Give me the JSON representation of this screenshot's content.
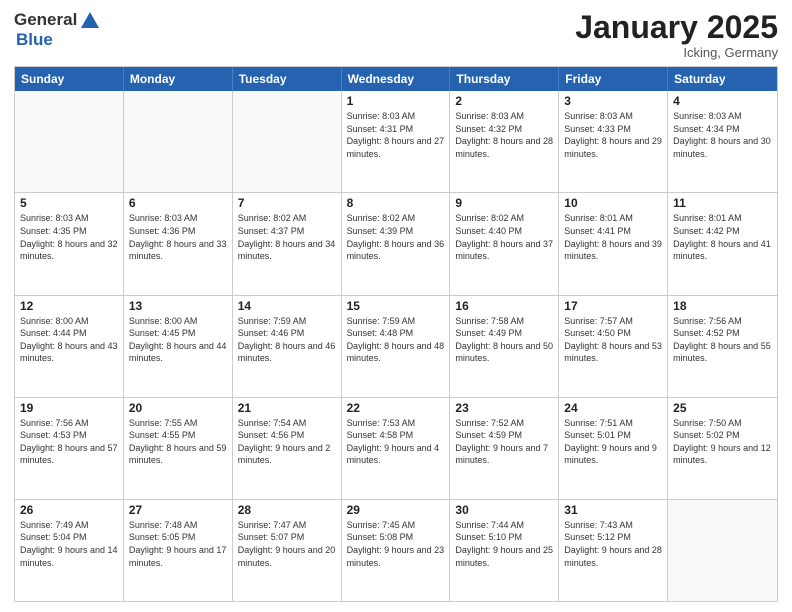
{
  "logo": {
    "general": "General",
    "blue": "Blue"
  },
  "header": {
    "month": "January 2025",
    "location": "Icking, Germany"
  },
  "weekdays": [
    "Sunday",
    "Monday",
    "Tuesday",
    "Wednesday",
    "Thursday",
    "Friday",
    "Saturday"
  ],
  "rows": [
    [
      {
        "day": "",
        "empty": true
      },
      {
        "day": "",
        "empty": true
      },
      {
        "day": "",
        "empty": true
      },
      {
        "day": "1",
        "sunrise": "8:03 AM",
        "sunset": "4:31 PM",
        "daylight": "8 hours and 27 minutes."
      },
      {
        "day": "2",
        "sunrise": "8:03 AM",
        "sunset": "4:32 PM",
        "daylight": "8 hours and 28 minutes."
      },
      {
        "day": "3",
        "sunrise": "8:03 AM",
        "sunset": "4:33 PM",
        "daylight": "8 hours and 29 minutes."
      },
      {
        "day": "4",
        "sunrise": "8:03 AM",
        "sunset": "4:34 PM",
        "daylight": "8 hours and 30 minutes."
      }
    ],
    [
      {
        "day": "5",
        "sunrise": "8:03 AM",
        "sunset": "4:35 PM",
        "daylight": "8 hours and 32 minutes."
      },
      {
        "day": "6",
        "sunrise": "8:03 AM",
        "sunset": "4:36 PM",
        "daylight": "8 hours and 33 minutes."
      },
      {
        "day": "7",
        "sunrise": "8:02 AM",
        "sunset": "4:37 PM",
        "daylight": "8 hours and 34 minutes."
      },
      {
        "day": "8",
        "sunrise": "8:02 AM",
        "sunset": "4:39 PM",
        "daylight": "8 hours and 36 minutes."
      },
      {
        "day": "9",
        "sunrise": "8:02 AM",
        "sunset": "4:40 PM",
        "daylight": "8 hours and 37 minutes."
      },
      {
        "day": "10",
        "sunrise": "8:01 AM",
        "sunset": "4:41 PM",
        "daylight": "8 hours and 39 minutes."
      },
      {
        "day": "11",
        "sunrise": "8:01 AM",
        "sunset": "4:42 PM",
        "daylight": "8 hours and 41 minutes."
      }
    ],
    [
      {
        "day": "12",
        "sunrise": "8:00 AM",
        "sunset": "4:44 PM",
        "daylight": "8 hours and 43 minutes."
      },
      {
        "day": "13",
        "sunrise": "8:00 AM",
        "sunset": "4:45 PM",
        "daylight": "8 hours and 44 minutes."
      },
      {
        "day": "14",
        "sunrise": "7:59 AM",
        "sunset": "4:46 PM",
        "daylight": "8 hours and 46 minutes."
      },
      {
        "day": "15",
        "sunrise": "7:59 AM",
        "sunset": "4:48 PM",
        "daylight": "8 hours and 48 minutes."
      },
      {
        "day": "16",
        "sunrise": "7:58 AM",
        "sunset": "4:49 PM",
        "daylight": "8 hours and 50 minutes."
      },
      {
        "day": "17",
        "sunrise": "7:57 AM",
        "sunset": "4:50 PM",
        "daylight": "8 hours and 53 minutes."
      },
      {
        "day": "18",
        "sunrise": "7:56 AM",
        "sunset": "4:52 PM",
        "daylight": "8 hours and 55 minutes."
      }
    ],
    [
      {
        "day": "19",
        "sunrise": "7:56 AM",
        "sunset": "4:53 PM",
        "daylight": "8 hours and 57 minutes."
      },
      {
        "day": "20",
        "sunrise": "7:55 AM",
        "sunset": "4:55 PM",
        "daylight": "8 hours and 59 minutes."
      },
      {
        "day": "21",
        "sunrise": "7:54 AM",
        "sunset": "4:56 PM",
        "daylight": "9 hours and 2 minutes."
      },
      {
        "day": "22",
        "sunrise": "7:53 AM",
        "sunset": "4:58 PM",
        "daylight": "9 hours and 4 minutes."
      },
      {
        "day": "23",
        "sunrise": "7:52 AM",
        "sunset": "4:59 PM",
        "daylight": "9 hours and 7 minutes."
      },
      {
        "day": "24",
        "sunrise": "7:51 AM",
        "sunset": "5:01 PM",
        "daylight": "9 hours and 9 minutes."
      },
      {
        "day": "25",
        "sunrise": "7:50 AM",
        "sunset": "5:02 PM",
        "daylight": "9 hours and 12 minutes."
      }
    ],
    [
      {
        "day": "26",
        "sunrise": "7:49 AM",
        "sunset": "5:04 PM",
        "daylight": "9 hours and 14 minutes."
      },
      {
        "day": "27",
        "sunrise": "7:48 AM",
        "sunset": "5:05 PM",
        "daylight": "9 hours and 17 minutes."
      },
      {
        "day": "28",
        "sunrise": "7:47 AM",
        "sunset": "5:07 PM",
        "daylight": "9 hours and 20 minutes."
      },
      {
        "day": "29",
        "sunrise": "7:45 AM",
        "sunset": "5:08 PM",
        "daylight": "9 hours and 23 minutes."
      },
      {
        "day": "30",
        "sunrise": "7:44 AM",
        "sunset": "5:10 PM",
        "daylight": "9 hours and 25 minutes."
      },
      {
        "day": "31",
        "sunrise": "7:43 AM",
        "sunset": "5:12 PM",
        "daylight": "9 hours and 28 minutes."
      },
      {
        "day": "",
        "empty": true
      }
    ]
  ],
  "labels": {
    "sunrise": "Sunrise:",
    "sunset": "Sunset:",
    "daylight": "Daylight hours"
  }
}
